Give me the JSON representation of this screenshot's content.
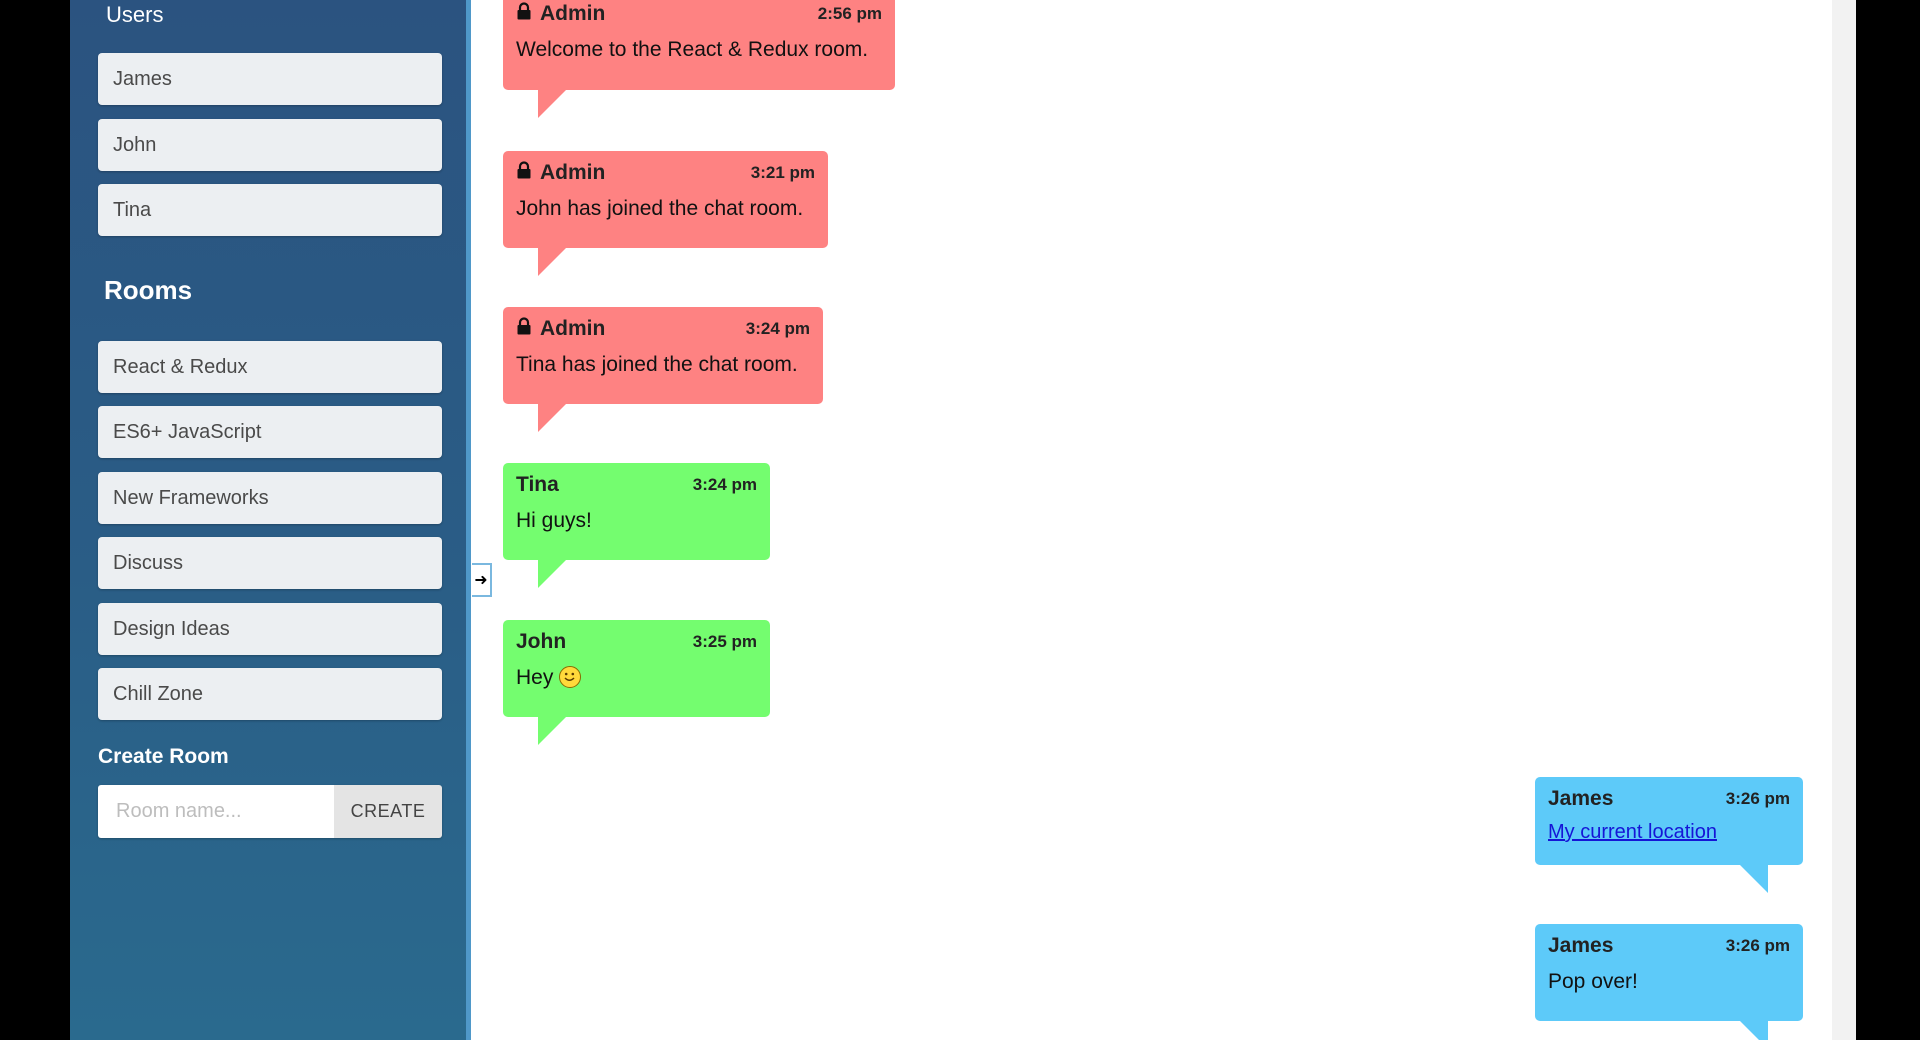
{
  "sidebar": {
    "users_title": "Users",
    "users": [
      "James",
      "John",
      "Tina"
    ],
    "rooms_title": "Rooms",
    "rooms": [
      "React & Redux",
      "ES6+ JavaScript",
      "New Frameworks",
      "Discuss",
      "Design Ideas",
      "Chill Zone"
    ],
    "create_title": "Create Room",
    "room_input_placeholder": "Room name...",
    "create_label": "CREATE"
  },
  "toggle": {
    "icon": "arrow-right-icon",
    "glyph": "➜"
  },
  "messages": [
    {
      "sender": "Admin",
      "time": "2:56 pm",
      "text": "Welcome to the React & Redux room.",
      "kind": "admin",
      "icon": "lock-icon"
    },
    {
      "sender": "Admin",
      "time": "3:21 pm",
      "text": "John has joined the chat room.",
      "kind": "admin",
      "icon": "lock-icon"
    },
    {
      "sender": "Admin",
      "time": "3:24 pm",
      "text": "Tina has joined the chat room.",
      "kind": "admin",
      "icon": "lock-icon"
    },
    {
      "sender": "Tina",
      "time": "3:24 pm",
      "text": "Hi guys!",
      "kind": "other"
    },
    {
      "sender": "John",
      "time": "3:25 pm",
      "text": "Hey",
      "kind": "other",
      "icon": "smiley-emoji-icon"
    },
    {
      "sender": "James",
      "time": "3:26 pm",
      "link": "My current location",
      "kind": "self"
    },
    {
      "sender": "James",
      "time": "3:26 pm",
      "text": "Pop over!",
      "kind": "self"
    }
  ],
  "colors": {
    "admin_bubble": "#fe8282",
    "other_bubble": "#74fd6f",
    "self_bubble": "#5dcaf9",
    "sidebar": "#2b5380"
  }
}
